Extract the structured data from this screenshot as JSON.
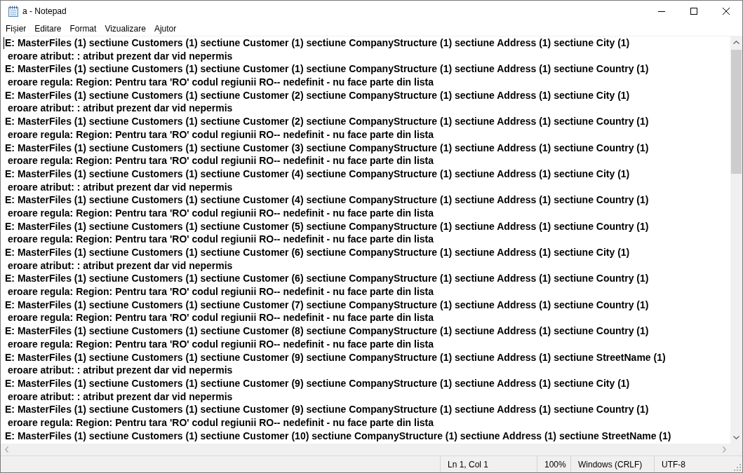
{
  "window": {
    "title": "a - Notepad"
  },
  "menu": [
    {
      "label": "Fișier"
    },
    {
      "label": "Editare"
    },
    {
      "label": "Format"
    },
    {
      "label": "Vizualizare"
    },
    {
      "label": "Ajutor"
    }
  ],
  "editor": {
    "lines": [
      "E: MasterFiles (1) sectiune Customers (1) sectiune Customer (1) sectiune CompanyStructure (1) sectiune Address (1) sectiune City (1)",
      " eroare atribut: : atribut prezent dar vid nepermis",
      "E: MasterFiles (1) sectiune Customers (1) sectiune Customer (1) sectiune CompanyStructure (1) sectiune Address (1) sectiune Country (1)",
      " eroare regula: Region: Pentru tara 'RO' codul regiunii RO-- nedefinit - nu face parte din lista",
      "E: MasterFiles (1) sectiune Customers (1) sectiune Customer (2) sectiune CompanyStructure (1) sectiune Address (1) sectiune City (1)",
      " eroare atribut: : atribut prezent dar vid nepermis",
      "E: MasterFiles (1) sectiune Customers (1) sectiune Customer (2) sectiune CompanyStructure (1) sectiune Address (1) sectiune Country (1)",
      " eroare regula: Region: Pentru tara 'RO' codul regiunii RO-- nedefinit - nu face parte din lista",
      "E: MasterFiles (1) sectiune Customers (1) sectiune Customer (3) sectiune CompanyStructure (1) sectiune Address (1) sectiune Country (1)",
      " eroare regula: Region: Pentru tara 'RO' codul regiunii RO-- nedefinit - nu face parte din lista",
      "E: MasterFiles (1) sectiune Customers (1) sectiune Customer (4) sectiune CompanyStructure (1) sectiune Address (1) sectiune City (1)",
      " eroare atribut: : atribut prezent dar vid nepermis",
      "E: MasterFiles (1) sectiune Customers (1) sectiune Customer (4) sectiune CompanyStructure (1) sectiune Address (1) sectiune Country (1)",
      " eroare regula: Region: Pentru tara 'RO' codul regiunii RO-- nedefinit - nu face parte din lista",
      "E: MasterFiles (1) sectiune Customers (1) sectiune Customer (5) sectiune CompanyStructure (1) sectiune Address (1) sectiune Country (1)",
      " eroare regula: Region: Pentru tara 'RO' codul regiunii RO-- nedefinit - nu face parte din lista",
      "E: MasterFiles (1) sectiune Customers (1) sectiune Customer (6) sectiune CompanyStructure (1) sectiune Address (1) sectiune City (1)",
      " eroare atribut: : atribut prezent dar vid nepermis",
      "E: MasterFiles (1) sectiune Customers (1) sectiune Customer (6) sectiune CompanyStructure (1) sectiune Address (1) sectiune Country (1)",
      " eroare regula: Region: Pentru tara 'RO' codul regiunii RO-- nedefinit - nu face parte din lista",
      "E: MasterFiles (1) sectiune Customers (1) sectiune Customer (7) sectiune CompanyStructure (1) sectiune Address (1) sectiune Country (1)",
      " eroare regula: Region: Pentru tara 'RO' codul regiunii RO-- nedefinit - nu face parte din lista",
      "E: MasterFiles (1) sectiune Customers (1) sectiune Customer (8) sectiune CompanyStructure (1) sectiune Address (1) sectiune Country (1)",
      " eroare regula: Region: Pentru tara 'RO' codul regiunii RO-- nedefinit - nu face parte din lista",
      "E: MasterFiles (1) sectiune Customers (1) sectiune Customer (9) sectiune CompanyStructure (1) sectiune Address (1) sectiune StreetName (1)",
      " eroare atribut: : atribut prezent dar vid nepermis",
      "E: MasterFiles (1) sectiune Customers (1) sectiune Customer (9) sectiune CompanyStructure (1) sectiune Address (1) sectiune City (1)",
      " eroare atribut: : atribut prezent dar vid nepermis",
      "E: MasterFiles (1) sectiune Customers (1) sectiune Customer (9) sectiune CompanyStructure (1) sectiune Address (1) sectiune Country (1)",
      " eroare regula: Region: Pentru tara 'RO' codul regiunii RO-- nedefinit - nu face parte din lista",
      "E: MasterFiles (1) sectiune Customers (1) sectiune Customer (10) sectiune CompanyStructure (1) sectiune Address (1) sectiune StreetName (1)"
    ]
  },
  "status_bar": {
    "position": "Ln 1, Col 1",
    "zoom": "100%",
    "line_ending": "Windows (CRLF)",
    "encoding": "UTF-8"
  }
}
